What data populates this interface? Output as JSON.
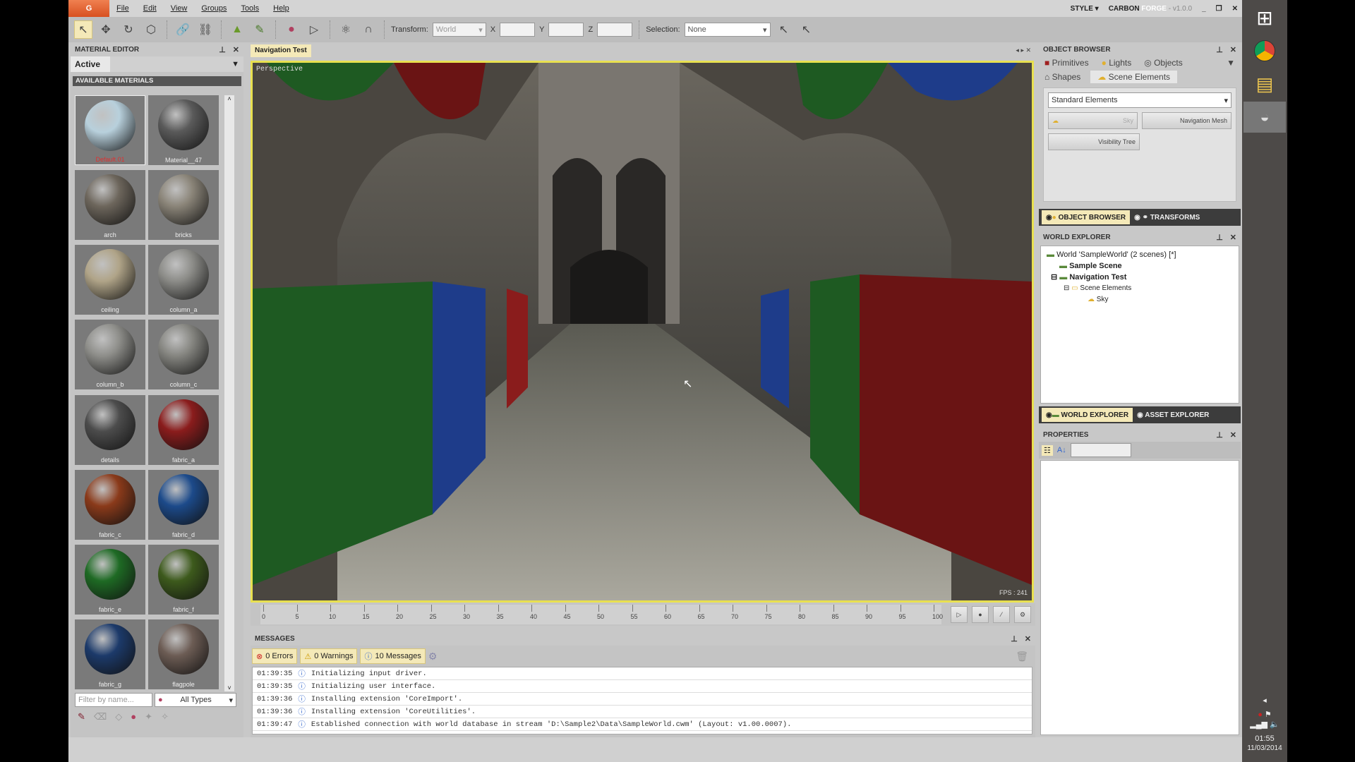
{
  "app": {
    "logo": "G",
    "menu": [
      "File",
      "Edit",
      "View",
      "Groups",
      "Tools",
      "Help"
    ],
    "style_label": "STYLE ▾",
    "brand_a": "CARBON",
    "brand_b": "FORGE",
    "version": "- v1.0.0"
  },
  "toolbar": {
    "transform_label": "Transform:",
    "transform_value": "World",
    "x": "X",
    "y": "Y",
    "z": "Z",
    "selection_label": "Selection:",
    "selection_value": "None"
  },
  "material_editor": {
    "title": "MATERIAL EDITOR",
    "tab": "Active",
    "section": "AVAILABLE MATERIALS",
    "filter_placeholder": "Filter by name...",
    "type_filter": "All Types",
    "materials": [
      {
        "name": "Default.01",
        "color": "#b8d0dc",
        "selected": true
      },
      {
        "name": "Material__47",
        "color": "#5a5a5a"
      },
      {
        "name": "arch",
        "color": "#6d665c"
      },
      {
        "name": "bricks",
        "color": "#8a8478"
      },
      {
        "name": "ceiling",
        "color": "#b0a488"
      },
      {
        "name": "column_a",
        "color": "#8c8c88"
      },
      {
        "name": "column_b",
        "color": "#8e8e8a"
      },
      {
        "name": "column_c",
        "color": "#858580"
      },
      {
        "name": "details",
        "color": "#4c4c4c"
      },
      {
        "name": "fabric_a",
        "color": "#8a1c1c"
      },
      {
        "name": "fabric_c",
        "color": "#8a3a1a"
      },
      {
        "name": "fabric_d",
        "color": "#1c4a8a"
      },
      {
        "name": "fabric_e",
        "color": "#1e6a24"
      },
      {
        "name": "fabric_f",
        "color": "#3d5a1c"
      },
      {
        "name": "fabric_g",
        "color": "#1c3a6a"
      },
      {
        "name": "flagpole",
        "color": "#6c5c54"
      }
    ]
  },
  "viewport": {
    "tab": "Navigation Test",
    "mode": "Perspective",
    "fps": "FPS : 241"
  },
  "timeline": {
    "ticks": [
      "0",
      "5",
      "10",
      "15",
      "20",
      "25",
      "30",
      "35",
      "40",
      "45",
      "50",
      "55",
      "60",
      "65",
      "70",
      "75",
      "80",
      "85",
      "90",
      "95",
      "100"
    ]
  },
  "messages": {
    "title": "MESSAGES",
    "errors": "0 Errors",
    "warnings": "0 Warnings",
    "messages": "10 Messages",
    "log": [
      {
        "time": "01:39:35",
        "text": "Initializing input driver."
      },
      {
        "time": "01:39:35",
        "text": "Initializing user interface."
      },
      {
        "time": "01:39:36",
        "text": "Installing extension 'CoreImport'."
      },
      {
        "time": "01:39:36",
        "text": "Installing extension 'CoreUtilities'."
      },
      {
        "time": "01:39:47",
        "text": "Established connection with world database in stream 'D:\\Sample2\\Data\\SampleWorld.cwm' (Layout: v1.00.0007)."
      }
    ]
  },
  "object_browser": {
    "title": "OBJECT BROWSER",
    "tabs": [
      "Primitives",
      "Lights",
      "Objects",
      "Shapes",
      "Scene Elements"
    ],
    "category": "Standard Elements",
    "buttons": [
      "Sky",
      "Navigation Mesh",
      "Visibility Tree"
    ],
    "dock_tabs": [
      "OBJECT BROWSER",
      "TRANSFORMS"
    ]
  },
  "world_explorer": {
    "title": "WORLD EXPLORER",
    "tree": [
      "World 'SampleWorld' (2 scenes) [*]",
      "Sample Scene",
      "Navigation Test",
      "Scene Elements",
      "Sky"
    ],
    "dock_tabs": [
      "WORLD EXPLORER",
      "ASSET EXPLORER"
    ]
  },
  "properties": {
    "title": "PROPERTIES"
  },
  "taskbar": {
    "time": "01:55",
    "date": "11/03/2014"
  },
  "colors": {
    "accent": "#e8e050",
    "tab_active": "#f4e9b8",
    "logo": "#e06a30"
  }
}
